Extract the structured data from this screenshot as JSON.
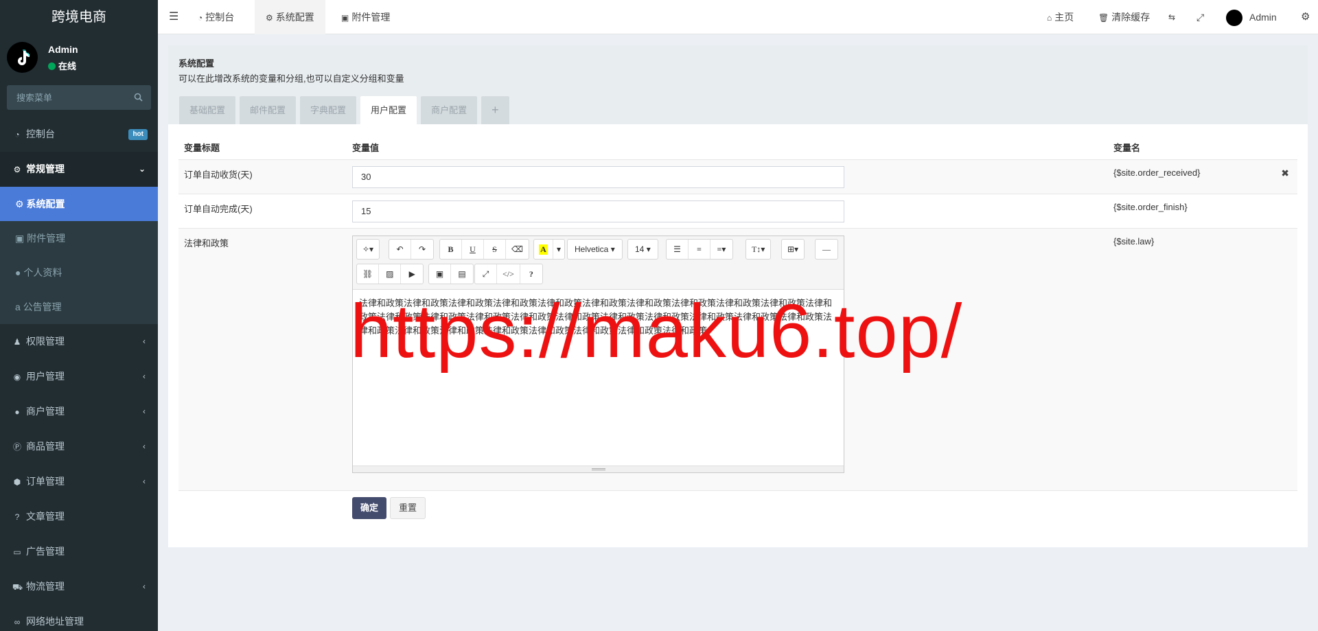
{
  "sidebar": {
    "logo": "跨境电商",
    "user_name": "Admin",
    "user_status": "在线",
    "search_placeholder": "搜索菜单",
    "menu": {
      "dashboard": {
        "label": "控制台",
        "badge": "hot"
      },
      "general": {
        "label": "常规管理"
      },
      "sub_config": {
        "label": "系统配置"
      },
      "sub_attach": {
        "label": "附件管理"
      },
      "sub_profile": {
        "label": "个人资料"
      },
      "sub_notice": {
        "label": "公告管理"
      },
      "auth": {
        "label": "权限管理"
      },
      "user": {
        "label": "用户管理"
      },
      "merchant": {
        "label": "商户管理"
      },
      "goods": {
        "label": "商品管理"
      },
      "order": {
        "label": "订单管理"
      },
      "article": {
        "label": "文章管理"
      },
      "ad": {
        "label": "广告管理"
      },
      "logistics": {
        "label": "物流管理"
      },
      "network": {
        "label": "网络地址管理"
      }
    }
  },
  "topbar": {
    "tabs": [
      "控制台",
      "系统配置",
      "附件管理"
    ],
    "home": "主页",
    "clear_cache": "清除缓存",
    "admin": "Admin"
  },
  "content": {
    "title": "系统配置",
    "desc": "可以在此增改系统的变量和分组,也可以自定义分组和变量",
    "tabs": [
      "基础配置",
      "邮件配置",
      "字典配置",
      "用户配置",
      "商户配置",
      "+"
    ],
    "headers": {
      "title": "变量标题",
      "value": "变量值",
      "name": "变量名"
    },
    "rows": [
      {
        "label": "订单自动收货(天)",
        "value": "30",
        "var": "{$site.order_received}"
      },
      {
        "label": "订单自动完成(天)",
        "value": "15",
        "var": "{$site.order_finish}"
      },
      {
        "label": "法律和政策",
        "var": "{$site.law}"
      }
    ],
    "editor": {
      "font": "Helvetica",
      "size": "14",
      "text": "法律和政策法律和政策法律和政策法律和政策法律和政策法律和政策法律和政策法律和政策法律和政策法律和政策法律和政策法律和政策法律和政策法律和政策法律和政策法律和政策法律和政策法律和政策法律和政策法律和政策法律和政策法律和政策法律和政策法律和政策法律和政策法律和政策法律和政策法律和政策法律和政策"
    },
    "ok": "确定",
    "reset": "重置"
  },
  "watermark": "https://maku6.top/"
}
